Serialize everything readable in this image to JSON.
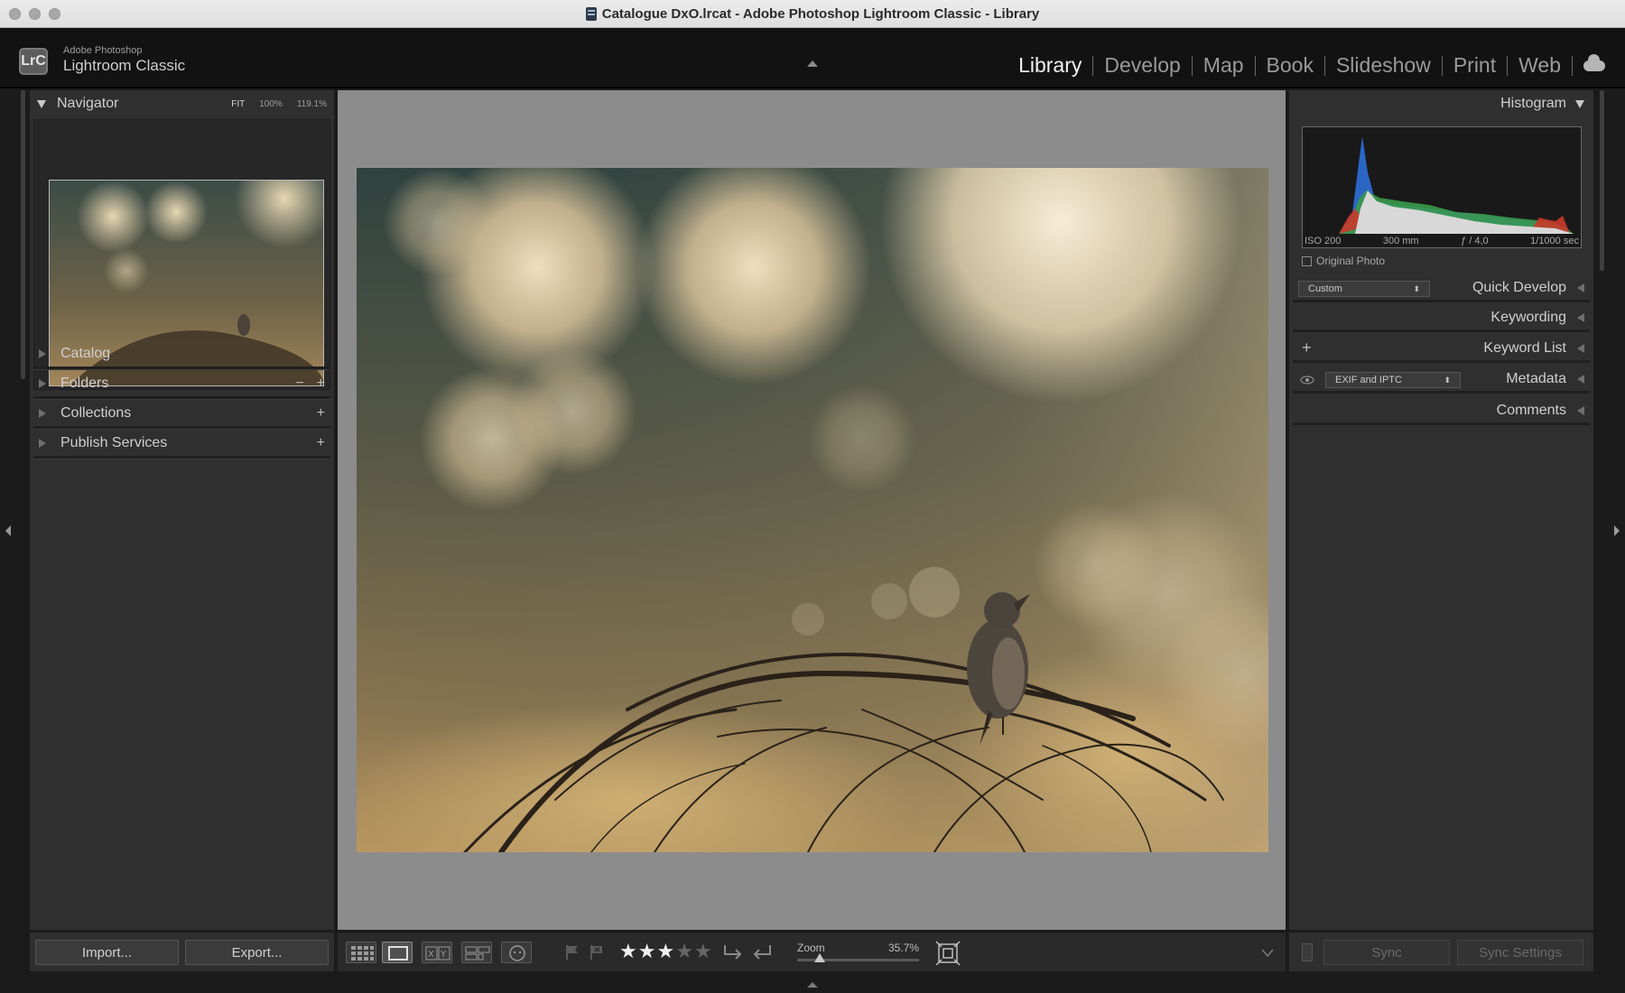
{
  "window": {
    "title": "Catalogue DxO.lrcat - Adobe Photoshop Lightroom Classic - Library"
  },
  "brand": {
    "logo": "LrC",
    "top": "Adobe Photoshop",
    "main": "Lightroom Classic"
  },
  "modules": [
    "Library",
    "Develop",
    "Map",
    "Book",
    "Slideshow",
    "Print",
    "Web"
  ],
  "left": {
    "navigator": {
      "title": "Navigator",
      "fit": "FIT",
      "z100": "100%",
      "z1191": "119.1%"
    },
    "catalog": "Catalog",
    "folders": "Folders",
    "collections": "Collections",
    "publish": "Publish Services",
    "import": "Import...",
    "export": "Export..."
  },
  "right": {
    "histogram": "Histogram",
    "iso": "ISO 200",
    "focal": "300 mm",
    "aperture": "ƒ / 4,0",
    "shutter": "1/1000 sec",
    "original": "Original Photo",
    "preset": "Custom",
    "quick_develop": "Quick Develop",
    "keywording": "Keywording",
    "keyword_list": "Keyword List",
    "metadata_preset": "EXIF and IPTC",
    "metadata": "Metadata",
    "comments": "Comments",
    "sync": "Sync",
    "sync_settings": "Sync Settings"
  },
  "toolbar": {
    "zoom_label": "Zoom",
    "zoom_value": "35.7%",
    "rating": 3,
    "rating_max": 5
  },
  "icons": [
    "grid-view-icon",
    "loupe-view-icon",
    "compare-view-icon",
    "survey-view-icon",
    "people-view-icon",
    "flag-icon",
    "reject-flag-icon",
    "rotate-left-icon",
    "rotate-right-icon",
    "crop-frame-icon"
  ],
  "colors": {
    "active_module": "#f2f2f2",
    "inactive_module": "#9a9a9a",
    "panel": "#2f2f2f",
    "background": "#8c8c8c"
  }
}
